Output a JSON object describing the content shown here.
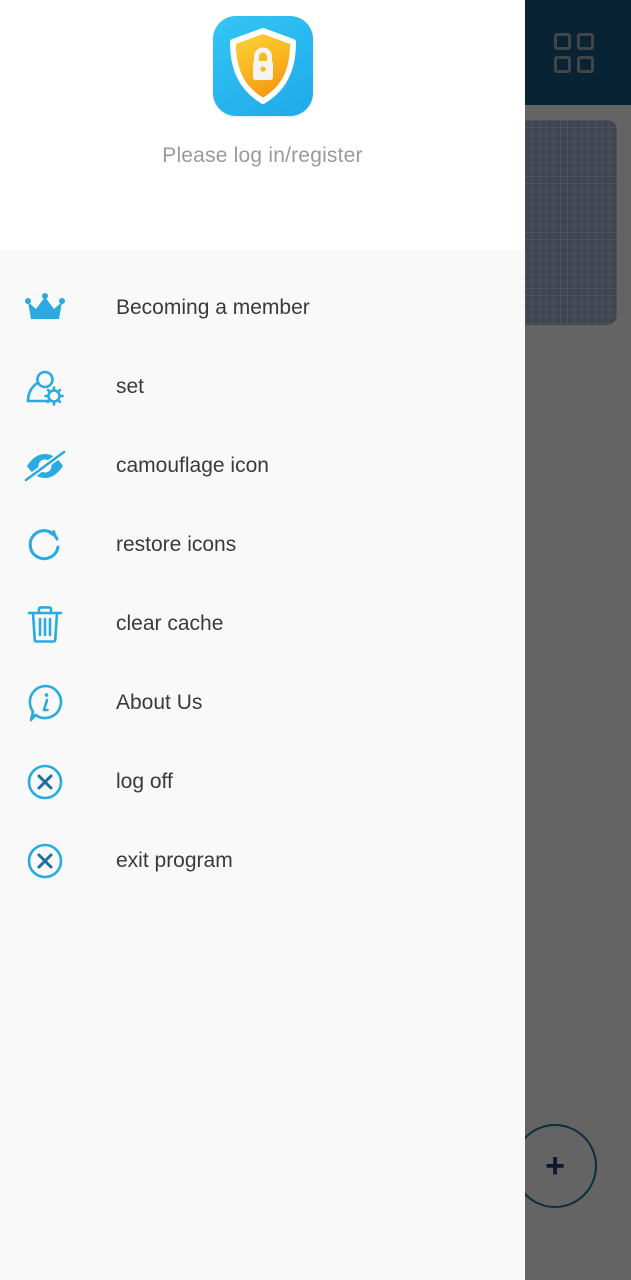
{
  "drawer": {
    "header": {
      "logo_icon": "shield-lock-icon",
      "logo_colors": {
        "background_start": "#34c6f4",
        "background_end": "#1fa9e8",
        "shield_fill_start": "#fcc12a",
        "shield_fill_end": "#f2a01c",
        "shield_outline": "#ffffff",
        "lock": "#f4f4f4"
      },
      "login_prompt": "Please log in/register"
    },
    "accent_color": "#29abe2",
    "menu": [
      {
        "label": "Becoming a member",
        "icon": "crown-icon"
      },
      {
        "label": "set",
        "icon": "user-settings-icon"
      },
      {
        "label": "camouflage icon",
        "icon": "eye-off-icon"
      },
      {
        "label": "restore icons",
        "icon": "refresh-icon"
      },
      {
        "label": "clear cache",
        "icon": "trash-icon"
      },
      {
        "label": "About Us",
        "icon": "info-bubble-icon"
      },
      {
        "label": "log off",
        "icon": "close-circle-icon"
      },
      {
        "label": "exit program",
        "icon": "close-circle-icon"
      }
    ]
  },
  "background_app": {
    "appbar": {
      "color": "#14567c",
      "grid_icon": "grid-apps-icon"
    },
    "card": {
      "dot_icon": "circle-outline-icon",
      "pattern": "graph-paper"
    },
    "fab": {
      "label": "+",
      "icon": "plus-icon",
      "color": "#1b6f8e"
    }
  }
}
